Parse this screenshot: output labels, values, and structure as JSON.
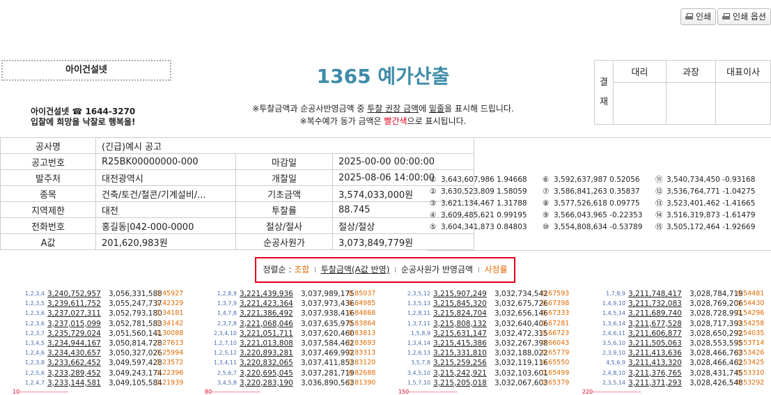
{
  "buttons": {
    "print": "인쇄",
    "print_options": "인쇄 옵션"
  },
  "company": {
    "name": "아이건설넷",
    "contact_line": "아이건설넷 ☎ 1644-3270",
    "slogan": "입찰에 희망을 낙찰로 행복을!"
  },
  "title": "1365 예가산출",
  "notice": {
    "line1_pre": "※투찰금액과 순공사반영금액 중 ",
    "line1_u": "투찰 권장 금액",
    "line1_mid": "에 ",
    "line1_u2": "밑줄",
    "line1_post": "을 표시해 드립니다.",
    "line2_pre": "※복수예가 동가 금액은 ",
    "line2_red": "빨간색",
    "line2_post": "으로 표시됩니다."
  },
  "approval": {
    "side1": "결",
    "side2": "재",
    "h1": "대리",
    "h2": "과장",
    "h3": "대표이사"
  },
  "info": {
    "rows": [
      {
        "l1": "공사명",
        "v1": "(긴급)예시 공고",
        "l2": "",
        "v2": ""
      },
      {
        "l1": "공고번호",
        "v1": "R25BK00000000-000",
        "l2": "마감일",
        "v2": "2025-00-00 00:00:00"
      },
      {
        "l1": "발주처",
        "v1": "대전광역시",
        "l2": "개찰일",
        "v2": "2025-08-06 14:00:00"
      },
      {
        "l1": "종목",
        "v1": "건축/토건/철콘/기계설비/...",
        "l2": "기초금액",
        "v2": "3,574,033,000원"
      },
      {
        "l1": "지역제한",
        "v1": "대전",
        "l2": "투찰률",
        "v2": "88.745"
      },
      {
        "l1": "전화번호",
        "v1": "홍길동|042-000-0000",
        "l2": "절상/절사",
        "v2": "절상/절상"
      },
      {
        "l1": "A값",
        "v1": "201,620,983원",
        "l2": "순공사원가",
        "v2": "3,073,849,779원"
      }
    ]
  },
  "reserve_prices": [
    {
      "no": "①",
      "amount": "3,643,607,986",
      "rate": "1.94668"
    },
    {
      "no": "②",
      "amount": "3,630,523,809",
      "rate": "1.58059"
    },
    {
      "no": "③",
      "amount": "3,621,134,467",
      "rate": "1.31788"
    },
    {
      "no": "④",
      "amount": "3,609,485,621",
      "rate": "0.99195"
    },
    {
      "no": "⑤",
      "amount": "3,604,341,873",
      "rate": "0.84803"
    },
    {
      "no": "⑥",
      "amount": "3,592,637,987",
      "rate": "0.52056"
    },
    {
      "no": "⑦",
      "amount": "3,586,841,263",
      "rate": "0.35837"
    },
    {
      "no": "⑧",
      "amount": "3,577,526,618",
      "rate": "0.09775"
    },
    {
      "no": "⑨",
      "amount": "3,566,043,965",
      "rate": "-0.22353"
    },
    {
      "no": "⑩",
      "amount": "3,554,808,634",
      "rate": "-0.53789"
    },
    {
      "no": "⑪",
      "amount": "3,540,734,450",
      "rate": "-0.93168"
    },
    {
      "no": "⑫",
      "amount": "3,536,764,771",
      "rate": "-1.04275"
    },
    {
      "no": "⑬",
      "amount": "3,523,401,462",
      "rate": "-1.41665"
    },
    {
      "no": "⑭",
      "amount": "3,516,319,873",
      "rate": "-1.61479"
    },
    {
      "no": "⑮",
      "amount": "3,505,172,464",
      "rate": "-1.92669"
    }
  ],
  "sort": {
    "prefix": "정렬순 :",
    "combo": "조합",
    "bid": "투찰금액(A값 반영)",
    "net": "순공사원가 반영금액",
    "rate": "사정률",
    "divider": "l"
  },
  "results": [
    {
      "marker": "10------------------------",
      "rows": [
        [
          "1,2,3,4",
          "3,240,752,957",
          "3,056,331,588",
          "1.45927"
        ],
        [
          "1,2,3,5",
          "3,239,611,752",
          "3,055,247,737",
          "1.42329"
        ],
        [
          "1,2,3,6",
          "3,237,027,311",
          "3,052,793,180",
          "1.34181"
        ],
        [
          "1,2,3,6",
          "3,237,015,099",
          "3,052,781,583",
          "1.34142"
        ],
        [
          "1,2,3,7",
          "3,235,729,024",
          "3,051,560,141",
          "1.30088"
        ],
        [
          "1,3,4,5",
          "3,234,944,167",
          "3,050,814,728",
          "1.27613"
        ],
        [
          "1,2,4,6",
          "3,234,430,657",
          "3,050,327,026",
          "1.25994"
        ],
        [
          "1,2,3,8",
          "3,233,662,452",
          "3,049,597,428",
          "1.23572"
        ],
        [
          "1,2,5,6",
          "3,233,289,452",
          "3,049,243,174",
          "1.22396"
        ],
        [
          "1,2,4,7",
          "3,233,144,581",
          "3,049,105,584",
          "1.21939"
        ]
      ]
    },
    {
      "marker": "80------------------------",
      "rows": [
        [
          "1,2,8,9",
          "3,221,439,936",
          "3,037,989,175",
          "0.85037"
        ],
        [
          "1,3,7,9",
          "3,221,423,364",
          "3,037,973,436",
          "0.84985"
        ],
        [
          "1,4,7,8",
          "3,221,386,492",
          "3,037,938,416",
          "0.84868"
        ],
        [
          "2,3,7,8",
          "3,221,068,046",
          "3,037,635,975",
          "0.83864"
        ],
        [
          "2,3,4,10",
          "3,221,051,711",
          "3,037,620,460",
          "0.83813"
        ],
        [
          "1,2,7,10",
          "3,221,013,808",
          "3,037,584,462",
          "0.83693"
        ],
        [
          "1,2,5,12",
          "3,220,893,281",
          "3,037,469,992",
          "0.83313"
        ],
        [
          "1,3,4,11",
          "3,220,832,065",
          "3,037,411,853",
          "0.83120"
        ],
        [
          "2,5,6,7",
          "3,220,695,045",
          "3,037,281,719",
          "0.82688"
        ],
        [
          "3,4,5,8",
          "3,220,283,190",
          "3,036,890,563",
          "0.81390"
        ]
      ]
    },
    {
      "marker": "150------------------------",
      "rows": [
        [
          "2,3,5,12",
          "3,215,907,249",
          "3,032,734,542",
          "0.67593"
        ],
        [
          "1,3,5,13",
          "3,215,845,320",
          "3,032,675,726",
          "0.67398"
        ],
        [
          "1,2,8,11",
          "3,215,824,704",
          "3,032,656,146",
          "0.67333"
        ],
        [
          "1,3,7,11",
          "3,215,808,132",
          "3,032,640,406",
          "0.67281"
        ],
        [
          "1,5,8,9",
          "3,215,631,147",
          "3,032,472,315",
          "0.66723"
        ],
        [
          "1,3,4,14",
          "3,215,415,386",
          "3,032,267,398",
          "0.66043"
        ],
        [
          "1,2,6,13",
          "3,215,331,810",
          "3,032,188,022",
          "0.65779"
        ],
        [
          "3,5,7,8",
          "3,215,259,256",
          "3,032,119,116",
          "0.65550"
        ],
        [
          "3,4,5,10",
          "3,215,242,921",
          "3,032,103,601",
          "0.65499"
        ],
        [
          "1,5,7,10",
          "3,215,205,018",
          "3,032,067,603",
          "0.65379"
        ]
      ]
    },
    {
      "marker": "220------------------------",
      "rows": [
        [
          "1,7,8,9",
          "3,211,748,417",
          "3,028,784,719",
          "0.54481"
        ],
        [
          "1,4,9,10",
          "3,211,732,083",
          "3,028,769,206",
          "0.54430"
        ],
        [
          "1,4,5,14",
          "3,211,689,740",
          "3,028,728,991",
          "0.54296"
        ],
        [
          "1,3,6,14",
          "3,211,677,528",
          "3,028,717,393",
          "0.54258"
        ],
        [
          "2,4,6,11",
          "3,211,606,877",
          "3,028,650,292",
          "0.54035"
        ],
        [
          "3,5,6,10",
          "3,211,505,063",
          "3,028,553,595",
          "0.53714"
        ],
        [
          "2,3,9,10",
          "3,211,413,636",
          "3,028,466,763",
          "0.53426"
        ],
        [
          "4,5,6,9",
          "3,211,413,320",
          "3,028,466,462",
          "0.53425"
        ],
        [
          "2,4,8,10",
          "3,211,376,765",
          "3,028,431,745",
          "0.53310"
        ],
        [
          "2,3,5,14",
          "3,211,371,293",
          "3,028,426,548",
          "0.53292"
        ]
      ]
    }
  ]
}
